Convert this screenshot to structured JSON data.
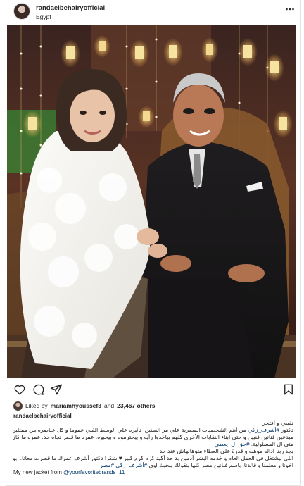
{
  "header": {
    "username": "randaelbehairyofficial",
    "location": "Egypt",
    "more_label": "•••"
  },
  "actions": {
    "like_icon": "heart-icon",
    "comment_icon": "comment-icon",
    "share_icon": "paper-plane-icon",
    "save_icon": "bookmark-icon"
  },
  "likes": {
    "prefix": "Liked by",
    "user": "mariamhyoussef3",
    "connector": "and",
    "count": "23,467 others"
  },
  "caption": {
    "username": "randaelbehairyofficial",
    "line1": "نقيبي و افتخر",
    "line2a": "دكتور ",
    "tag1": "#أشرف_زكي",
    "line2b": " من أهم الشخصيات المصرية علي مر السنين. تأثيره علي الوسط الفني عموماً و كل عناصره من ممثلين",
    "line3": "مبدعين فنانين فنيين و حتي ابناء النقابات الأخري كلهم بياخدوا رأيه و بيحترموه و بيحبوه. عمره ما قصر تجاه حد. عمره ما كان",
    "line4a": "متي ال المسئولية. ",
    "tag2": "#حق_ل_يعطي",
    "line5": "بجد ربنا اداله موهبه و قدرة علي العطاء متوهالهاش عند حد",
    "line6": "اللي بيشتغل في العمل العام و خدمه البشر أدمين بد حد أكيد كرم كرم كبير ♥ شكرا دكتور أشرف عمرك ما قصرت معانا. ابونا و",
    "line7a": "اخونا و معلمنا و قائدنا. باسم فنانين مصر كلها بنقولك بنحبك اوي ",
    "tag3": "#أشرف_زكي",
    "tag4": "#مصر",
    "line8a": "My new jacket from ",
    "mention": "@yourfavoritebrands_11"
  },
  "colors": {
    "link": "#00376b",
    "border": "#e3e3e3",
    "text": "#262626"
  }
}
